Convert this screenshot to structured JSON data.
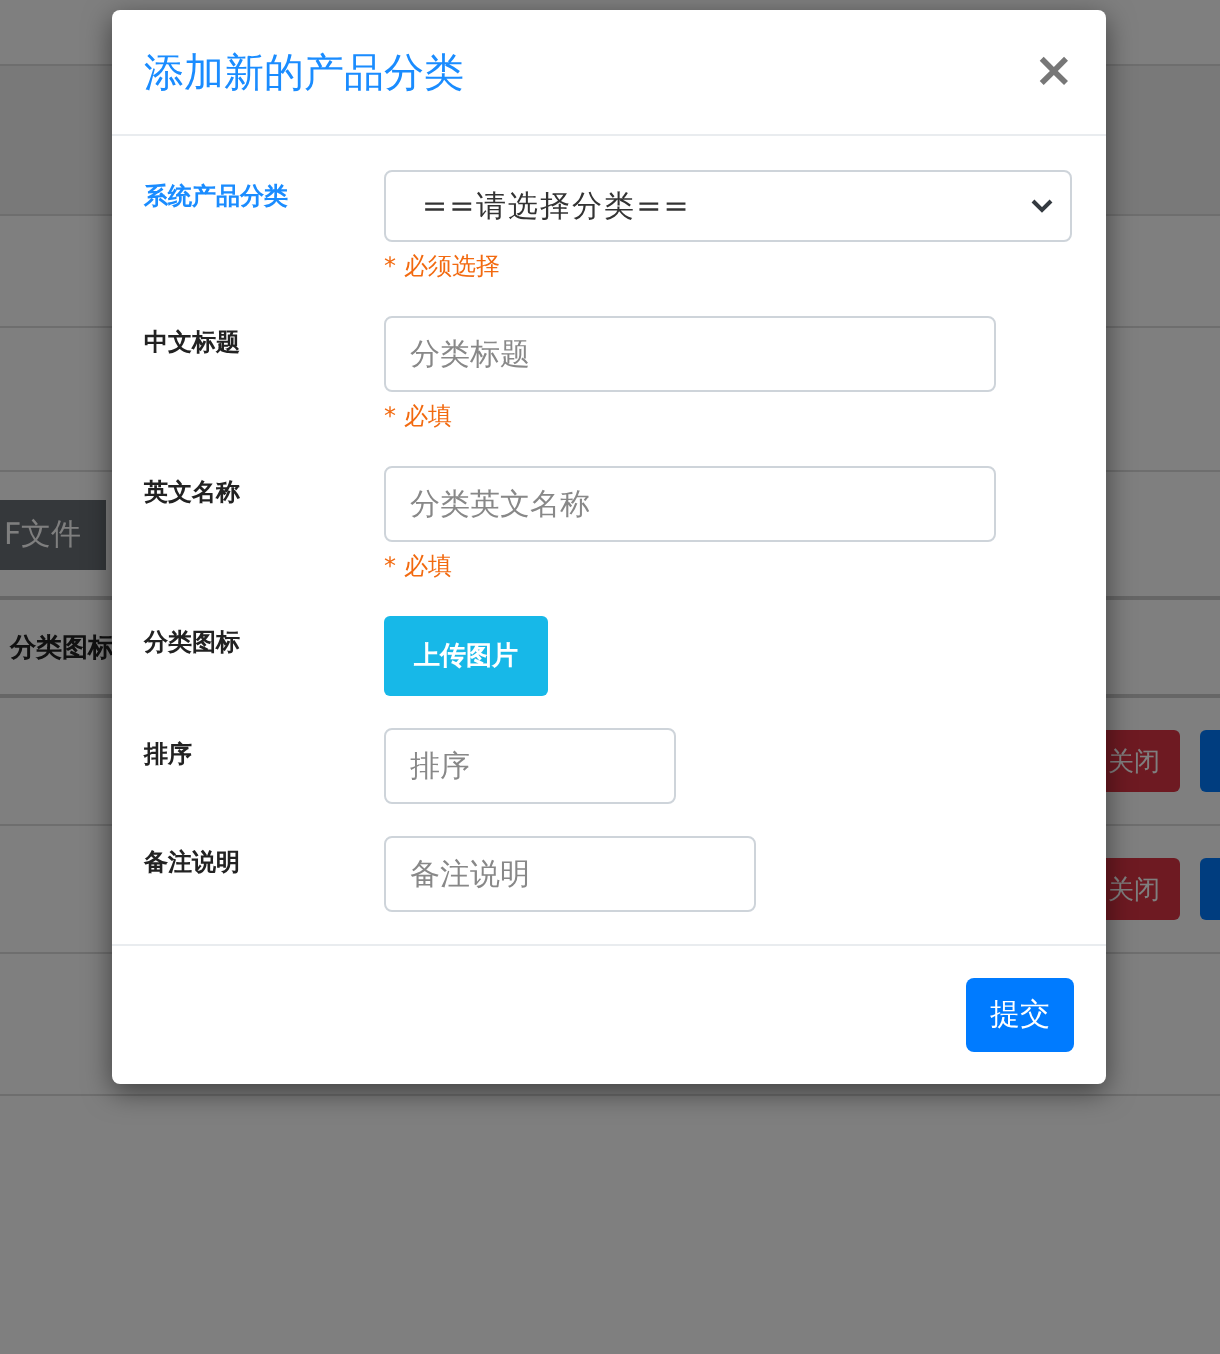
{
  "background": {
    "file_button": "F文件",
    "table_header": "分类图标",
    "rows": [
      {
        "close_button": "关闭"
      },
      {
        "close_button": "关闭"
      }
    ]
  },
  "modal": {
    "title": "添加新的产品分类",
    "close": "×",
    "fields": [
      {
        "kind": "select",
        "label": "系统产品分类",
        "active": true,
        "value": "==请选择分类==",
        "hint": "* 必须选择"
      },
      {
        "kind": "text",
        "label": "中文标题",
        "active": false,
        "placeholder": "分类标题",
        "hint": "* 必填"
      },
      {
        "kind": "text",
        "label": "英文名称",
        "active": false,
        "placeholder": "分类英文名称",
        "hint": "* 必填"
      },
      {
        "kind": "upload",
        "label": "分类图标",
        "active": false,
        "button": "上传图片"
      },
      {
        "kind": "short",
        "label": "排序",
        "active": false,
        "placeholder": "排序"
      },
      {
        "kind": "memo",
        "label": "备注说明",
        "active": false,
        "placeholder": "备注说明"
      }
    ],
    "submit": "提交"
  }
}
